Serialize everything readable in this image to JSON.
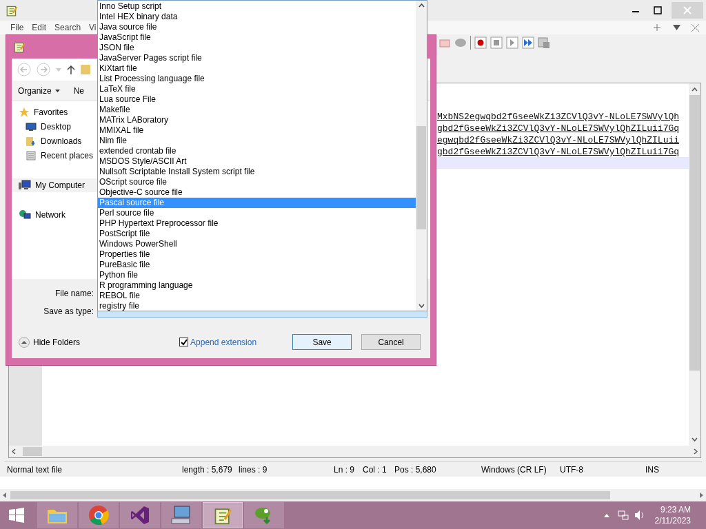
{
  "menu": [
    "File",
    "Edit",
    "Search",
    "Vi"
  ],
  "editor": {
    "lines": [
      {
        "kind": "blank",
        "current": false
      },
      {
        "kind": "text",
        "text": "MxbNS2egwqbd2fGseeWkZi3ZCVlQ3vY-NLoLE7SWVylQh",
        "current": false
      },
      {
        "kind": "text",
        "text": "gbd2fGseeWkZi3ZCVlQ3vY-NLoLE7SWVylQhZILuii7Gq",
        "current": false
      },
      {
        "kind": "text",
        "text": "egwqbd2fGseeWkZi3ZCVlQ3vY-NLoLE7SWVylQhZILuii",
        "current": false
      },
      {
        "kind": "text",
        "text": "gbd2fGseeWkZi3ZCVlQ3vY-NLoLE7SWVylQhZILuii7Gq",
        "current": false
      },
      {
        "kind": "blank",
        "current": true
      }
    ]
  },
  "status_bar": {
    "type": "Normal text file",
    "length": "length : 5,679",
    "lines": "lines : 9",
    "ln": "Ln : 9",
    "col": "Col : 1",
    "pos": "Pos : 5,680",
    "eol": "Windows (CR LF)",
    "encoding": "UTF-8",
    "mode": "INS"
  },
  "dialog": {
    "organize": "Organize",
    "new_folder": "Ne",
    "nav": [
      {
        "label": "Favorites",
        "kind": "star",
        "indent": false,
        "selected": false
      },
      {
        "label": "Desktop",
        "kind": "desktop",
        "indent": true,
        "selected": false
      },
      {
        "label": "Downloads",
        "kind": "download",
        "indent": true,
        "selected": false
      },
      {
        "label": "Recent places",
        "kind": "recent",
        "indent": true,
        "selected": false
      },
      {
        "label": "My Computer",
        "kind": "computer",
        "indent": false,
        "selected": true
      },
      {
        "label": "Network",
        "kind": "network",
        "indent": false,
        "selected": false
      }
    ],
    "file_name_label": "File name:",
    "save_type_label": "Save as type:",
    "hide_folders": "Hide Folders",
    "append_extension": {
      "label": "Append extension",
      "checked": true
    },
    "save": "Save",
    "cancel": "Cancel"
  },
  "dropdown": {
    "items": [
      {
        "label": "Inno Setup script",
        "selected": false
      },
      {
        "label": "Intel HEX binary data",
        "selected": false
      },
      {
        "label": "Java source file",
        "selected": false
      },
      {
        "label": "JavaScript file",
        "selected": false
      },
      {
        "label": "JSON file",
        "selected": false
      },
      {
        "label": "JavaServer Pages script file",
        "selected": false
      },
      {
        "label": "KiXtart file",
        "selected": false
      },
      {
        "label": "List Processing language file",
        "selected": false
      },
      {
        "label": "LaTeX file",
        "selected": false
      },
      {
        "label": "Lua source File",
        "selected": false
      },
      {
        "label": "Makefile",
        "selected": false
      },
      {
        "label": "MATrix LABoratory",
        "selected": false
      },
      {
        "label": "MMIXAL file",
        "selected": false
      },
      {
        "label": "Nim file",
        "selected": false
      },
      {
        "label": "extended crontab file",
        "selected": false
      },
      {
        "label": "MSDOS Style/ASCII Art",
        "selected": false
      },
      {
        "label": "Nullsoft Scriptable Install System script file",
        "selected": false
      },
      {
        "label": "OScript source file",
        "selected": false
      },
      {
        "label": "Objective-C source file",
        "selected": false
      },
      {
        "label": "Pascal source file",
        "selected": true
      },
      {
        "label": "Perl source file",
        "selected": false
      },
      {
        "label": "PHP Hypertext Preprocessor file",
        "selected": false
      },
      {
        "label": "PostScript file",
        "selected": false
      },
      {
        "label": "Windows PowerShell",
        "selected": false
      },
      {
        "label": "Properties file",
        "selected": false
      },
      {
        "label": "PureBasic file",
        "selected": false
      },
      {
        "label": "Python file",
        "selected": false
      },
      {
        "label": "R programming language",
        "selected": false
      },
      {
        "label": "REBOL file",
        "selected": false
      },
      {
        "label": "registry file",
        "selected": false
      }
    ]
  },
  "taskbar": {
    "apps": [
      {
        "kind": "folder",
        "active": false
      },
      {
        "kind": "chrome",
        "active": false
      },
      {
        "kind": "vs",
        "active": false
      },
      {
        "kind": "computer",
        "active": false
      },
      {
        "kind": "notepad",
        "active": true
      },
      {
        "kind": "chameleon",
        "active": false
      }
    ],
    "time": "9:23 AM",
    "date": "2/11/2023"
  }
}
